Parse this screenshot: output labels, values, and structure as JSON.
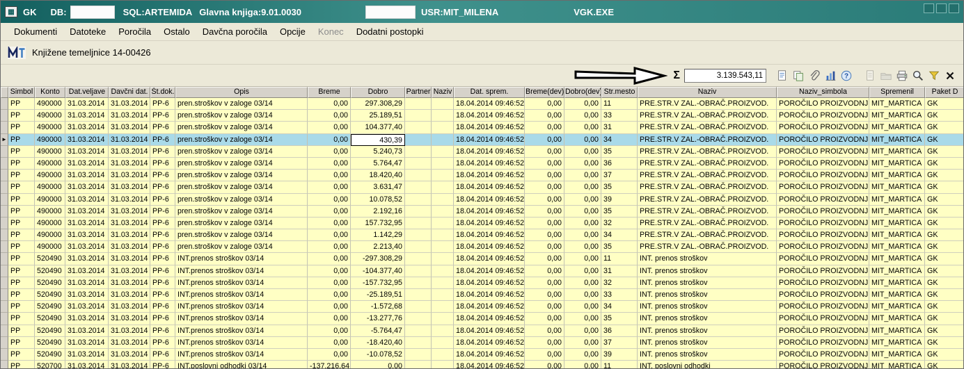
{
  "title_bar": {
    "app": "GK",
    "db_label": "DB:",
    "sql": "SQL:ARTEMIDA",
    "version": "Glavna knjiga:9.01.0030",
    "user": "USR:MIT_MILENA",
    "exe": "VGK.EXE"
  },
  "menu_items": [
    {
      "label": "Dokumenti",
      "enabled": true
    },
    {
      "label": "Datoteke",
      "enabled": true
    },
    {
      "label": "Poročila",
      "enabled": true
    },
    {
      "label": "Ostalo",
      "enabled": true
    },
    {
      "label": "Davčna poročila",
      "enabled": true
    },
    {
      "label": "Opcije",
      "enabled": true
    },
    {
      "label": "Konec",
      "enabled": false
    },
    {
      "label": "Dodatni postopki",
      "enabled": true
    }
  ],
  "caption": {
    "title": "Knjižene temeljnice 14-00426"
  },
  "sum_bar": {
    "sigma": "Σ",
    "value": "3.139.543,11"
  },
  "toolbar_icons": {
    "group1": [
      {
        "name": "export-report-icon",
        "disabled": false
      },
      {
        "name": "copy-grid-icon",
        "disabled": false
      },
      {
        "name": "attachment-icon",
        "disabled": false
      },
      {
        "name": "chart-icon",
        "disabled": false
      },
      {
        "name": "help-icon",
        "disabled": false
      }
    ],
    "group2": [
      {
        "name": "new-doc-icon",
        "disabled": true
      },
      {
        "name": "open-folder-icon",
        "disabled": true
      },
      {
        "name": "print-icon",
        "disabled": false
      },
      {
        "name": "search-icon",
        "disabled": false
      },
      {
        "name": "filter-icon",
        "disabled": false
      },
      {
        "name": "close-icon",
        "disabled": false
      }
    ]
  },
  "table": {
    "headers": [
      "Simbol",
      "Konto",
      "Dat.veljave",
      "Davčni dat.",
      "Št.dok.",
      "Opis",
      "Breme",
      "Dobro",
      "Partner",
      "Naziv",
      "Dat. sprem.",
      "Breme(dev)",
      "Dobro(dev)",
      "Str.mesto",
      "Naziv",
      "Naziv_simbola",
      "Spremenil",
      "Paket D"
    ],
    "selected_row": 3,
    "selected_col": 7,
    "rows": [
      [
        "PP",
        "490000",
        "31.03.2014",
        "31.03.2014",
        "PP-6",
        "pren.stroškov v zaloge 03/14",
        "0,00",
        "297.308,29",
        "",
        "",
        "18.04.2014 09:46:52",
        "0,00",
        "0,00",
        "11",
        "PRE.STR.V ZAL.-OBRAČ.PROIZVOD.",
        "POROČILO PROIZVODNJE",
        "MIT_MARTICA",
        "GK"
      ],
      [
        "PP",
        "490000",
        "31.03.2014",
        "31.03.2014",
        "PP-6",
        "pren.stroškov v zaloge 03/14",
        "0,00",
        "25.189,51",
        "",
        "",
        "18.04.2014 09:46:52",
        "0,00",
        "0,00",
        "33",
        "PRE.STR.V ZAL.-OBRAČ.PROIZVOD.",
        "POROČILO PROIZVODNJE",
        "MIT_MARTICA",
        "GK"
      ],
      [
        "PP",
        "490000",
        "31.03.2014",
        "31.03.2014",
        "PP-6",
        "pren.stroškov v zaloge 03/14",
        "0,00",
        "104.377,40",
        "",
        "",
        "18.04.2014 09:46:52",
        "0,00",
        "0,00",
        "31",
        "PRE.STR.V ZAL.-OBRAČ.PROIZVOD.",
        "POROČILO PROIZVODNJE",
        "MIT_MARTICA",
        "GK"
      ],
      [
        "PP",
        "490000",
        "31.03.2014",
        "31.03.2014",
        "PP-6",
        "pren.stroškov v zaloge 03/14",
        "0,00",
        "430,39",
        "",
        "",
        "18.04.2014 09:46:52",
        "0,00",
        "0,00",
        "34",
        "PRE.STR.V ZAL.-OBRAČ.PROIZVOD.",
        "POROČILO PROIZVODNJE",
        "MIT_MARTICA",
        "GK"
      ],
      [
        "PP",
        "490000",
        "31.03.2014",
        "31.03.2014",
        "PP-6",
        "pren.stroškov v zaloge 03/14",
        "0,00",
        "5.240,73",
        "",
        "",
        "18.04.2014 09:46:52",
        "0,00",
        "0,00",
        "35",
        "PRE.STR.V ZAL.-OBRAČ.PROIZVOD.",
        "POROČILO PROIZVODNJE",
        "MIT_MARTICA",
        "GK"
      ],
      [
        "PP",
        "490000",
        "31.03.2014",
        "31.03.2014",
        "PP-6",
        "pren.stroškov v zaloge 03/14",
        "0,00",
        "5.764,47",
        "",
        "",
        "18.04.2014 09:46:52",
        "0,00",
        "0,00",
        "36",
        "PRE.STR.V ZAL.-OBRAČ.PROIZVOD.",
        "POROČILO PROIZVODNJE",
        "MIT_MARTICA",
        "GK"
      ],
      [
        "PP",
        "490000",
        "31.03.2014",
        "31.03.2014",
        "PP-6",
        "pren.stroškov v zaloge 03/14",
        "0,00",
        "18.420,40",
        "",
        "",
        "18.04.2014 09:46:52",
        "0,00",
        "0,00",
        "37",
        "PRE.STR.V ZAL.-OBRAČ.PROIZVOD.",
        "POROČILO PROIZVODNJE",
        "MIT_MARTICA",
        "GK"
      ],
      [
        "PP",
        "490000",
        "31.03.2014",
        "31.03.2014",
        "PP-6",
        "pren.stroškov v zaloge 03/14",
        "0,00",
        "3.631,47",
        "",
        "",
        "18.04.2014 09:46:52",
        "0,00",
        "0,00",
        "35",
        "PRE.STR.V ZAL.-OBRAČ.PROIZVOD.",
        "POROČILO PROIZVODNJE",
        "MIT_MARTICA",
        "GK"
      ],
      [
        "PP",
        "490000",
        "31.03.2014",
        "31.03.2014",
        "PP-6",
        "pren.stroškov v zaloge 03/14",
        "0,00",
        "10.078,52",
        "",
        "",
        "18.04.2014 09:46:52",
        "0,00",
        "0,00",
        "39",
        "PRE.STR.V ZAL.-OBRAČ.PROIZVOD.",
        "POROČILO PROIZVODNJE",
        "MIT_MARTICA",
        "GK"
      ],
      [
        "PP",
        "490000",
        "31.03.2014",
        "31.03.2014",
        "PP-6",
        "pren.stroškov v zaloge 03/14",
        "0,00",
        "2.192,16",
        "",
        "",
        "18.04.2014 09:46:52",
        "0,00",
        "0,00",
        "35",
        "PRE.STR.V ZAL.-OBRAČ.PROIZVOD.",
        "POROČILO PROIZVODNJE",
        "MIT_MARTICA",
        "GK"
      ],
      [
        "PP",
        "490000",
        "31.03.2014",
        "31.03.2014",
        "PP-6",
        "pren.stroškov v zaloge 03/14",
        "0,00",
        "157.732,95",
        "",
        "",
        "18.04.2014 09:46:52",
        "0,00",
        "0,00",
        "32",
        "PRE.STR.V ZAL.-OBRAČ.PROIZVOD.",
        "POROČILO PROIZVODNJE",
        "MIT_MARTICA",
        "GK"
      ],
      [
        "PP",
        "490000",
        "31.03.2014",
        "31.03.2014",
        "PP-6",
        "pren.stroškov v zaloge 03/14",
        "0,00",
        "1.142,29",
        "",
        "",
        "18.04.2014 09:46:52",
        "0,00",
        "0,00",
        "34",
        "PRE.STR.V ZAL.-OBRAČ.PROIZVOD.",
        "POROČILO PROIZVODNJE",
        "MIT_MARTICA",
        "GK"
      ],
      [
        "PP",
        "490000",
        "31.03.2014",
        "31.03.2014",
        "PP-6",
        "pren.stroškov v zaloge 03/14",
        "0,00",
        "2.213,40",
        "",
        "",
        "18.04.2014 09:46:52",
        "0,00",
        "0,00",
        "35",
        "PRE.STR.V ZAL.-OBRAČ.PROIZVOD.",
        "POROČILO PROIZVODNJE",
        "MIT_MARTICA",
        "GK"
      ],
      [
        "PP",
        "520490",
        "31.03.2014",
        "31.03.2014",
        "PP-6",
        "INT.prenos stroškov 03/14",
        "0,00",
        "-297.308,29",
        "",
        "",
        "18.04.2014 09:46:52",
        "0,00",
        "0,00",
        "11",
        "INT. prenos stroškov",
        "POROČILO PROIZVODNJE",
        "MIT_MARTICA",
        "GK"
      ],
      [
        "PP",
        "520490",
        "31.03.2014",
        "31.03.2014",
        "PP-6",
        "INT.prenos stroškov 03/14",
        "0,00",
        "-104.377,40",
        "",
        "",
        "18.04.2014 09:46:52",
        "0,00",
        "0,00",
        "31",
        "INT. prenos stroškov",
        "POROČILO PROIZVODNJE",
        "MIT_MARTICA",
        "GK"
      ],
      [
        "PP",
        "520490",
        "31.03.2014",
        "31.03.2014",
        "PP-6",
        "INT.prenos stroškov 03/14",
        "0,00",
        "-157.732,95",
        "",
        "",
        "18.04.2014 09:46:52",
        "0,00",
        "0,00",
        "32",
        "INT. prenos stroškov",
        "POROČILO PROIZVODNJE",
        "MIT_MARTICA",
        "GK"
      ],
      [
        "PP",
        "520490",
        "31.03.2014",
        "31.03.2014",
        "PP-6",
        "INT.prenos stroškov 03/14",
        "0,00",
        "-25.189,51",
        "",
        "",
        "18.04.2014 09:46:52",
        "0,00",
        "0,00",
        "33",
        "INT. prenos stroškov",
        "POROČILO PROIZVODNJE",
        "MIT_MARTICA",
        "GK"
      ],
      [
        "PP",
        "520490",
        "31.03.2014",
        "31.03.2014",
        "PP-6",
        "INT.prenos stroškov 03/14",
        "0,00",
        "-1.572,68",
        "",
        "",
        "18.04.2014 09:46:52",
        "0,00",
        "0,00",
        "34",
        "INT. prenos stroškov",
        "POROČILO PROIZVODNJE",
        "MIT_MARTICA",
        "GK"
      ],
      [
        "PP",
        "520490",
        "31.03.2014",
        "31.03.2014",
        "PP-6",
        "INT.prenos stroškov 03/14",
        "0,00",
        "-13.277,76",
        "",
        "",
        "18.04.2014 09:46:52",
        "0,00",
        "0,00",
        "35",
        "INT. prenos stroškov",
        "POROČILO PROIZVODNJE",
        "MIT_MARTICA",
        "GK"
      ],
      [
        "PP",
        "520490",
        "31.03.2014",
        "31.03.2014",
        "PP-6",
        "INT.prenos stroškov 03/14",
        "0,00",
        "-5.764,47",
        "",
        "",
        "18.04.2014 09:46:52",
        "0,00",
        "0,00",
        "36",
        "INT. prenos stroškov",
        "POROČILO PROIZVODNJE",
        "MIT_MARTICA",
        "GK"
      ],
      [
        "PP",
        "520490",
        "31.03.2014",
        "31.03.2014",
        "PP-6",
        "INT.prenos stroškov 03/14",
        "0,00",
        "-18.420,40",
        "",
        "",
        "18.04.2014 09:46:52",
        "0,00",
        "0,00",
        "37",
        "INT. prenos stroškov",
        "POROČILO PROIZVODNJE",
        "MIT_MARTICA",
        "GK"
      ],
      [
        "PP",
        "520490",
        "31.03.2014",
        "31.03.2014",
        "PP-6",
        "INT.prenos stroškov 03/14",
        "0,00",
        "-10.078,52",
        "",
        "",
        "18.04.2014 09:46:52",
        "0,00",
        "0,00",
        "39",
        "INT. prenos stroškov",
        "POROČILO PROIZVODNJE",
        "MIT_MARTICA",
        "GK"
      ],
      [
        "PP",
        "520700",
        "31.03.2014",
        "31.03.2014",
        "PP-6",
        "INT.poslovni odhodki 03/14",
        "-137.216,64",
        "0,00",
        "",
        "",
        "18.04.2014 09:46:52",
        "0,00",
        "0,00",
        "11",
        "INT. poslovni odhodki",
        "POROČILO PROIZVODNJE",
        "MIT_MARTICA",
        "GK"
      ]
    ]
  },
  "colors": {
    "titlebar_teal": "#2a7b78",
    "row_yellow": "#ffffc4",
    "row_selected": "#a9dae9",
    "header_gray": "#d6d2ca"
  }
}
